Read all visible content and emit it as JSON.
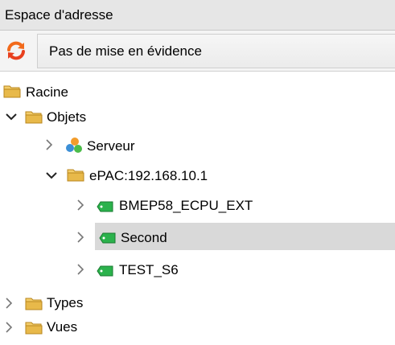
{
  "panel": {
    "title": "Espace d'adresse",
    "highlight_select": {
      "value": "Pas de mise en évidence"
    },
    "refresh_icon": "refresh-arrows-icon"
  },
  "tree": {
    "root": {
      "label": "Racine",
      "icon": "folder-icon"
    },
    "objects": {
      "label": "Objets",
      "icon": "folder-icon",
      "expanded": true
    },
    "server": {
      "label": "Serveur",
      "icon": "server-icon",
      "expanded": false
    },
    "epac": {
      "label": "ePAC:192.168.10.1",
      "icon": "folder-icon",
      "expanded": true
    },
    "bmep": {
      "label": "BMEP58_ECPU_EXT",
      "icon": "green-tag-icon",
      "expanded": false
    },
    "second": {
      "label": "Second",
      "icon": "green-tag-icon",
      "expanded": false,
      "selected": true
    },
    "test": {
      "label": "TEST_S6",
      "icon": "green-tag-icon",
      "expanded": false
    },
    "types": {
      "label": "Types",
      "icon": "folder-icon",
      "expanded": false
    },
    "vues": {
      "label": "Vues",
      "icon": "folder-icon",
      "expanded": false
    }
  },
  "colors": {
    "header_bg": "#e6e6e6",
    "selection_bg": "#d9d9d9",
    "folder": "#e8b94a",
    "tag_green": "#2bb24c",
    "refresh_orange": "#f26a1b"
  }
}
